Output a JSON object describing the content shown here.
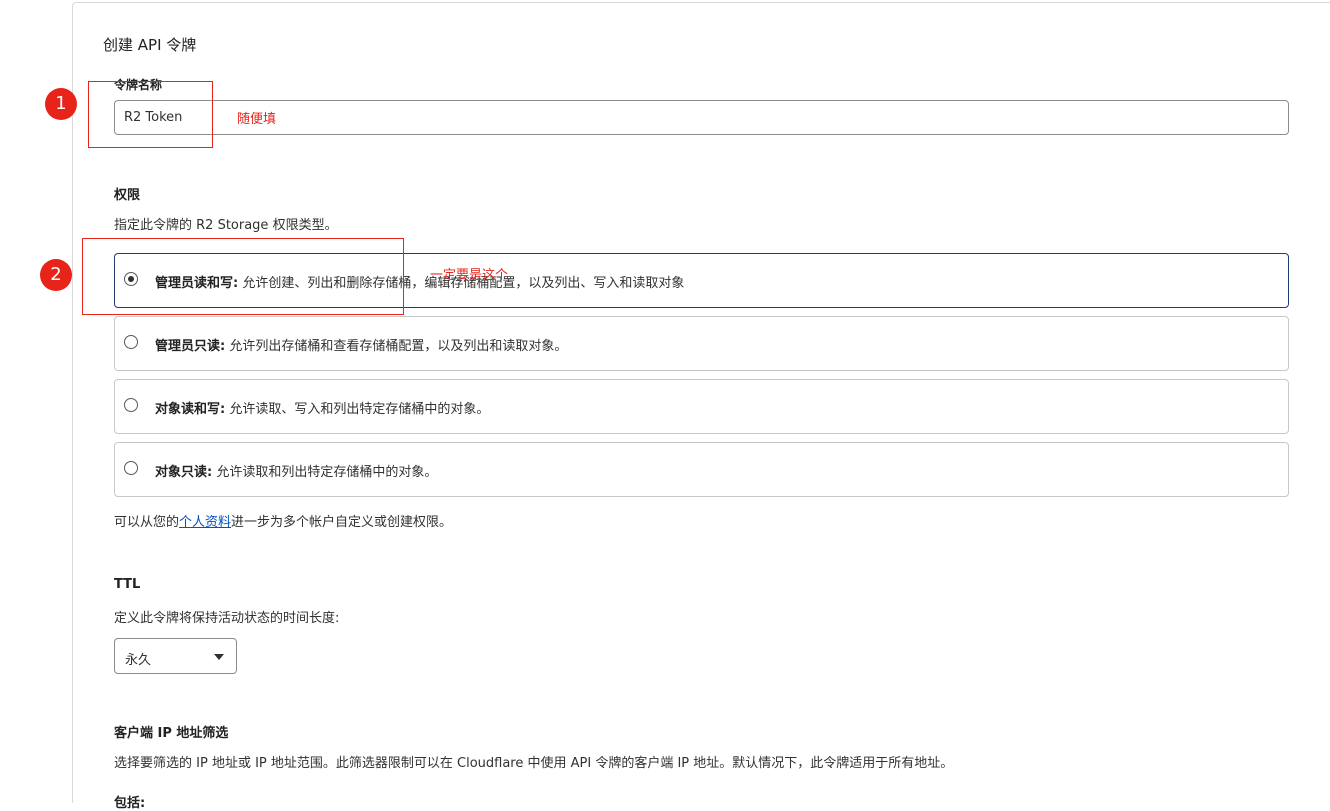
{
  "page": {
    "title": "创建 API 令牌"
  },
  "token_name": {
    "label": "令牌名称",
    "value": "R2 Token"
  },
  "permissions": {
    "heading": "权限",
    "description": "指定此令牌的 R2 Storage 权限类型。",
    "options": [
      {
        "title": "管理员读和写:",
        "desc": "允许创建、列出和删除存储桶，编辑存储桶配置，以及列出、写入和读取对象",
        "selected": true
      },
      {
        "title": "管理员只读:",
        "desc": "允许列出存储桶和查看存储桶配置，以及列出和读取对象。",
        "selected": false
      },
      {
        "title": "对象读和写:",
        "desc": "允许读取、写入和列出特定存储桶中的对象。",
        "selected": false
      },
      {
        "title": "对象只读:",
        "desc": "允许读取和列出特定存储桶中的对象。",
        "selected": false
      }
    ],
    "footer_prefix": "可以从您的",
    "footer_link": "个人资料",
    "footer_suffix": "进一步为多个帐户自定义或创建权限。"
  },
  "ttl": {
    "heading": "TTL",
    "description": "定义此令牌将保持活动状态的时间长度:",
    "selected": "永久"
  },
  "client_ip": {
    "heading": "客户端 IP 地址筛选",
    "description": "选择要筛选的 IP 地址或 IP 地址范围。此筛选器限制可以在 Cloudflare 中使用 API 令牌的客户端 IP 地址。默认情况下，此令牌适用于所有地址。",
    "include_label": "包括:"
  },
  "annotations": {
    "marker_1": "1",
    "marker_2": "2",
    "note_1": "随便填",
    "note_2": "一定要是这个",
    "color": "#e8231a"
  },
  "colors": {
    "link": "#0051c3",
    "selected_border": "#1f3f6e"
  }
}
